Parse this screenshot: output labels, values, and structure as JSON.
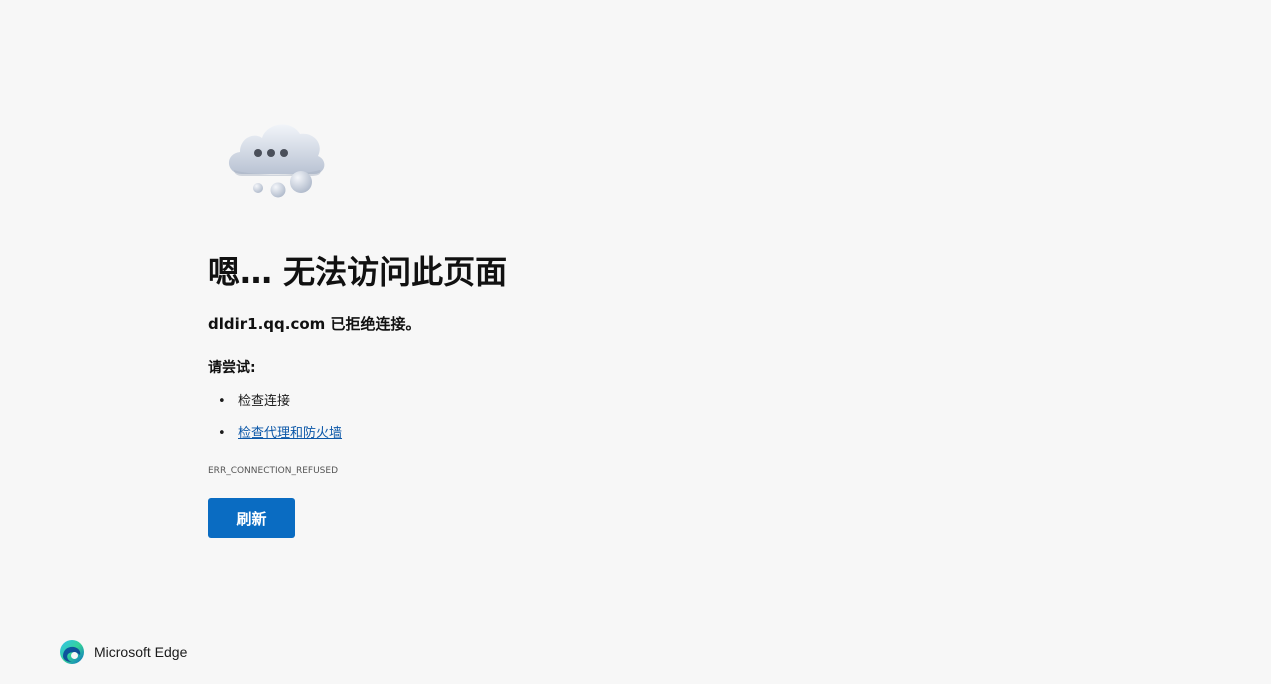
{
  "error_page": {
    "title": "嗯… 无法访问此页面",
    "host": "dldir1.qq.com",
    "host_message": "已拒绝连接。",
    "try_heading": "请尝试:",
    "suggestions": [
      {
        "label": "检查连接",
        "is_link": false
      },
      {
        "label": "检查代理和防火墙",
        "is_link": true
      }
    ],
    "error_code": "ERR_CONNECTION_REFUSED",
    "refresh_label": "刷新"
  },
  "brand": {
    "name": "Microsoft Edge",
    "icon": "edge-logo-icon"
  },
  "illustration": {
    "icon": "cloud-error-icon"
  },
  "colors": {
    "background": "#f7f7f7",
    "button": "#0a6cc2",
    "link": "#0b57a8"
  }
}
